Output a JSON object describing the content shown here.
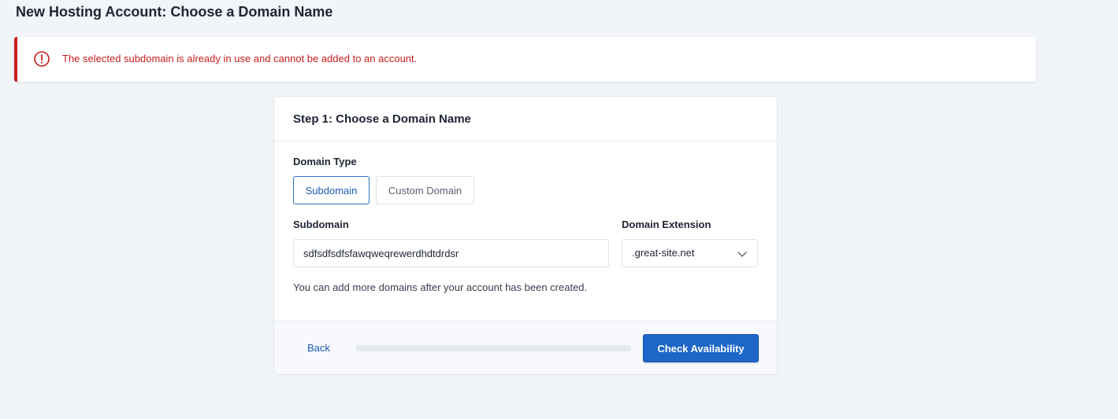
{
  "page": {
    "title": "New Hosting Account: Choose a Domain Name"
  },
  "alert": {
    "icon": "exclamation-circle-icon",
    "message": "The selected subdomain is already in use and cannot be added to an account.",
    "color": "#c81e1e"
  },
  "step": {
    "title": "Step 1: Choose a Domain Name",
    "domain_type_label": "Domain Type",
    "domain_types": [
      {
        "label": "Subdomain",
        "selected": true
      },
      {
        "label": "Custom Domain",
        "selected": false
      }
    ],
    "subdomain_label": "Subdomain",
    "subdomain_value": "sdfsdfsdfsfawqweqrewerdhdtdrdsr",
    "extension_label": "Domain Extension",
    "extension_value": ".great-site.net",
    "help_text": "You can add more domains after your account has been created."
  },
  "footer": {
    "back_label": "Back",
    "progress_percent": 0,
    "check_label": "Check Availability"
  },
  "colors": {
    "accent": "#1e66c7",
    "error": "#c81e1e",
    "background": "#f1f4f9"
  }
}
